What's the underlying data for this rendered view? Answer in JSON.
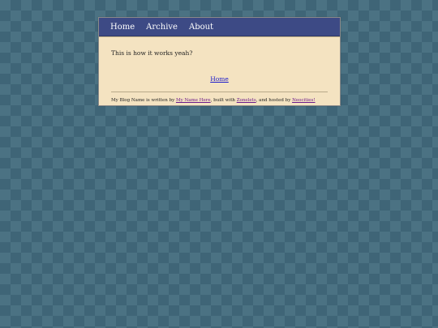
{
  "nav": {
    "items": [
      {
        "label": "Home"
      },
      {
        "label": "Archive"
      },
      {
        "label": "About"
      }
    ]
  },
  "post": {
    "text": "This is how it works yeah?",
    "home_link": "Home"
  },
  "footer": {
    "prefix": "My Blog Name is written by ",
    "author_link": "My Name Here",
    "mid1": ", built with ",
    "builder_link": "Zonelets",
    "mid2": ", and hosted by ",
    "host_link": "Neocities!"
  },
  "colors": {
    "background": "#4b7283",
    "navbar": "#3d4a85",
    "content": "#f4e3c1",
    "link": "#1a1acc",
    "visited_link": "#6a1a8a"
  }
}
